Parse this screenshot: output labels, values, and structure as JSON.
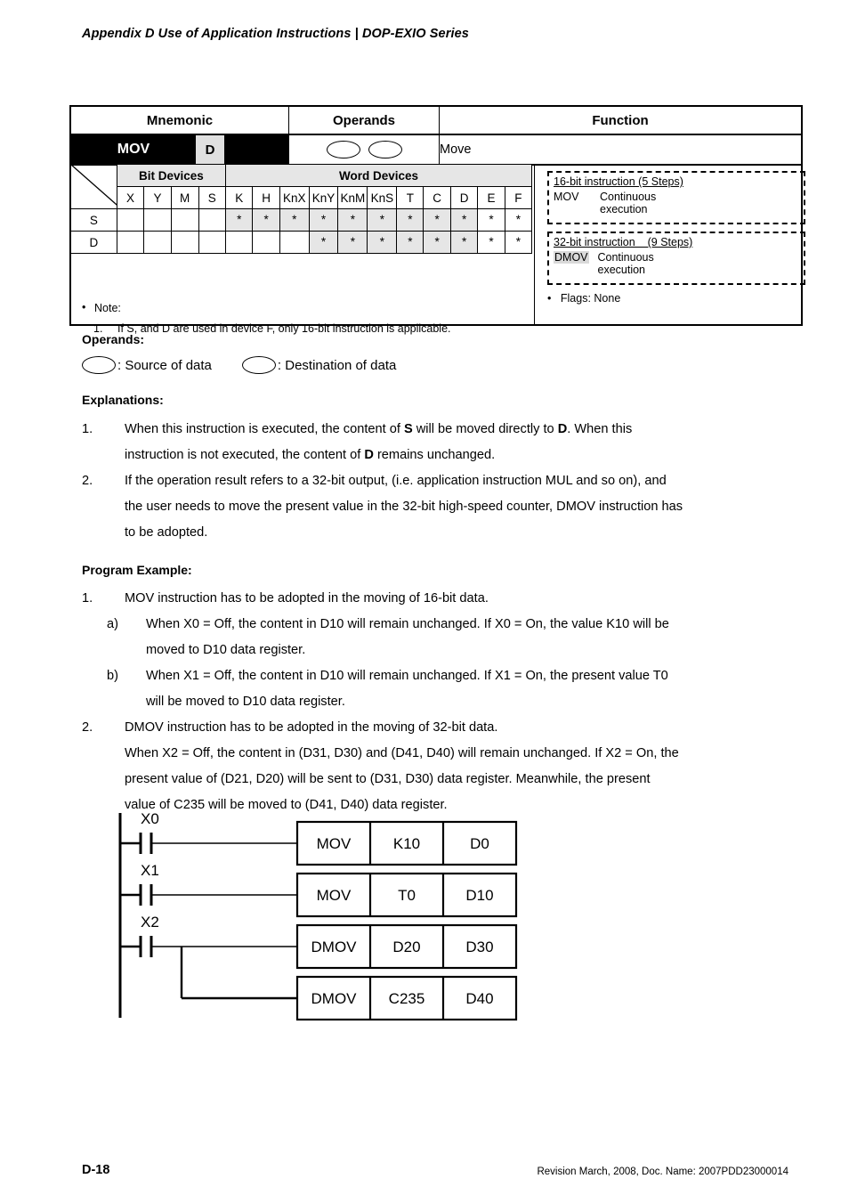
{
  "header": {
    "title": "Appendix D Use of Application Instructions | DOP-EXIO Series"
  },
  "instruction_table": {
    "headers": {
      "mnemonic": "Mnemonic",
      "operands": "Operands",
      "function": "Function"
    },
    "row": {
      "mnemonic": "MOV",
      "d_flag": "D",
      "function": "Move"
    }
  },
  "device_table": {
    "group_headers": {
      "bit": "Bit Devices",
      "word": "Word Devices"
    },
    "columns": [
      "X",
      "Y",
      "M",
      "S",
      "K",
      "H",
      "KnX",
      "KnY",
      "KnM",
      "KnS",
      "T",
      "C",
      "D",
      "E",
      "F"
    ],
    "rows": [
      {
        "label": "S",
        "marks": [
          "",
          "",
          "",
          "",
          "*",
          "*",
          "*",
          "*",
          "*",
          "*",
          "*",
          "*",
          "*",
          "*",
          "*"
        ]
      },
      {
        "label": "D",
        "marks": [
          "",
          "",
          "",
          "",
          "",
          "",
          "",
          "*",
          "*",
          "*",
          "*",
          "*",
          "*",
          "*",
          "*"
        ]
      }
    ],
    "note_label": "Note:",
    "note_number": "1.",
    "note_text": "If S, and D are used in device F, only 16-bit instruction is applicable."
  },
  "info_panel": {
    "box16": {
      "title": "16-bit instruction (5 Steps)",
      "op": "MOV",
      "exec_line1": "Continuous",
      "exec_line2": "execution"
    },
    "box32": {
      "title": "32-bit instruction    (9 Steps)",
      "op": "DMOV",
      "exec_line1": "Continuous",
      "exec_line2": "execution"
    },
    "flags": "Flags: None"
  },
  "operands_section": {
    "title": "Operands:",
    "source_label": ": Source of data",
    "destination_label": ": Destination of data"
  },
  "explanations": {
    "title": "Explanations:",
    "items": [
      {
        "marker": "1.",
        "line1_a": "When this instruction is executed, the content of ",
        "bold1": "S",
        "line1_b": " will be moved directly to ",
        "bold2": "D",
        "line1_c": ". When this",
        "line2_a": "instruction is not executed, the content of ",
        "bold3": "D",
        "line2_b": " remains unchanged."
      },
      {
        "marker": "2.",
        "line1": "If the operation result refers to a 32-bit output, (i.e. application instruction MUL and so on), and",
        "line2": "the user needs to move the present value in the 32-bit high-speed counter, DMOV instruction has",
        "line3": "to be adopted."
      }
    ]
  },
  "program_example": {
    "title": "Program Example:",
    "item1": {
      "marker": "1.",
      "text": "MOV instruction has to be adopted in the moving of 16-bit data.",
      "sub_a": {
        "marker": "a)",
        "line1": "When X0 = Off, the content in D10 will remain unchanged. If X0 = On, the value K10 will be",
        "line2": "moved to D10 data register."
      },
      "sub_b": {
        "marker": "b)",
        "line1": "When X1 = Off, the content in D10 will remain unchanged. If X1 = On, the present value T0",
        "line2": "will be moved to D10 data register."
      }
    },
    "item2": {
      "marker": "2.",
      "line1": "DMOV instruction has to be adopted in the moving of 32-bit data.",
      "line2": "When X2 = Off, the content in (D31, D30) and (D41, D40) will remain unchanged. If X2 = On, the",
      "line3": "present value of (D21, D20) will be sent to (D31, D30) data register. Meanwhile, the present",
      "line4": "value of C235 will be moved to (D41, D40) data register."
    }
  },
  "ladder": {
    "rungs": [
      {
        "contact": "X0",
        "instruction": "MOV",
        "source": "K10",
        "destination": "D0"
      },
      {
        "contact": "X1",
        "instruction": "MOV",
        "source": "T0",
        "destination": "D10"
      },
      {
        "contact": "X2",
        "instruction": "DMOV",
        "source": "D20",
        "destination": "D30"
      },
      {
        "contact": "",
        "instruction": "DMOV",
        "source": "C235",
        "destination": "D40"
      }
    ]
  },
  "footer": {
    "page_number": "D-18",
    "revision": "Revision March, 2008, Doc. Name: 2007PDD23000014"
  },
  "colors": {
    "shade": "#e6e6e6",
    "black": "#000000",
    "gray_box": "#e0e0e0"
  }
}
